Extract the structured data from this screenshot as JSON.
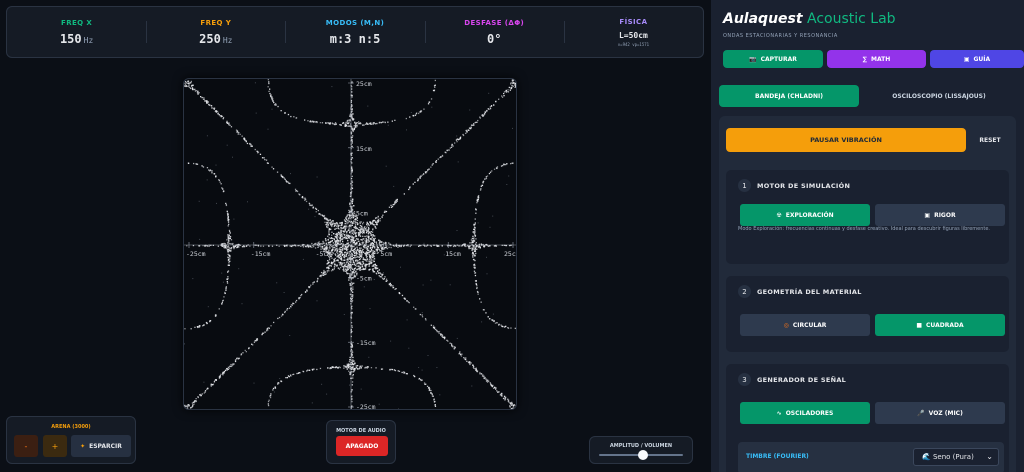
{
  "stats": [
    {
      "label": "FREQ X",
      "value": "150",
      "unit": "Hz",
      "color": "#10b981"
    },
    {
      "label": "FREQ Y",
      "value": "250",
      "unit": "Hz",
      "color": "#f59e0b"
    },
    {
      "label": "MODOS (M,N)",
      "value": "m:3 n:5",
      "unit": "",
      "color": "#38bdf8"
    },
    {
      "label": "DESFASE (ΔΦ)",
      "value": "0°",
      "unit": "",
      "color": "#d946ef"
    },
    {
      "label": "FÍSICA",
      "value": "L=50cm",
      "unit": "",
      "sub": "v=942 vp=1571",
      "color": "#a78bfa"
    }
  ],
  "plate": {
    "x_ticks": [
      "-25cm",
      "-15cm",
      "-5cm",
      "5cm",
      "15cm",
      "25c"
    ],
    "y_ticks": [
      "25cm",
      "15cm",
      "5cm",
      "-5cm",
      "-15cm",
      "-25cm"
    ],
    "mode_m": 3,
    "mode_n": 5
  },
  "sand": {
    "label": "ARENA (3000)",
    "minus": "-",
    "plus": "+",
    "spread": "ESPARCIR",
    "spread_icon": "✦"
  },
  "motor": {
    "label": "MOTOR DE AUDIO",
    "button": "APAGADO"
  },
  "amplitude": {
    "label": "AMPLITUD / VOLUMEN",
    "level_percent": 52
  },
  "panel": {
    "brand_a": "Aulaquest",
    "brand_b": " Acoustic Lab",
    "subtitle": "ONDAS ESTACIONARIAS Y RESONANCIA",
    "top_buttons": [
      {
        "icon": "📷",
        "label": "CAPTURAR",
        "color": "#059669"
      },
      {
        "icon": "∑",
        "label": "MATH",
        "color": "#9333ea"
      },
      {
        "icon": "▣",
        "label": "GUÍA",
        "color": "#4f46e5"
      }
    ],
    "tabs": [
      "BANDEJA (CHLADNI)",
      "OSCILOSCOPIO (LISSAJOUS)"
    ],
    "pause": "PAUSAR VIBRACIÓN",
    "reset": "RESET",
    "sections": [
      {
        "num": "1",
        "title": "MOTOR DE SIMULACIÓN",
        "options": [
          {
            "icon": "☢",
            "label": "EXPLORACIÓN"
          },
          {
            "icon": "▣",
            "label": "RIGOR"
          }
        ],
        "desc": "Modo Exploración: frecuencias continuas y desfase creativo. Ideal para descubrir figuras libremente."
      },
      {
        "num": "2",
        "title": "GEOMETRÍA DEL MATERIAL",
        "options": [
          {
            "icon": "◎",
            "label": "CIRCULAR"
          },
          {
            "icon": "■",
            "label": "CUADRADA"
          }
        ]
      },
      {
        "num": "3",
        "title": "GENERADOR DE SEÑAL",
        "options": [
          {
            "icon": "∿",
            "label": "OSCILADORES"
          },
          {
            "icon": "🎤",
            "label": "VOZ (MIC)"
          }
        ]
      }
    ],
    "timbre_label": "TIMBRE (FOURIER)",
    "timbre_value": "🌊 Seno (Pura)"
  }
}
